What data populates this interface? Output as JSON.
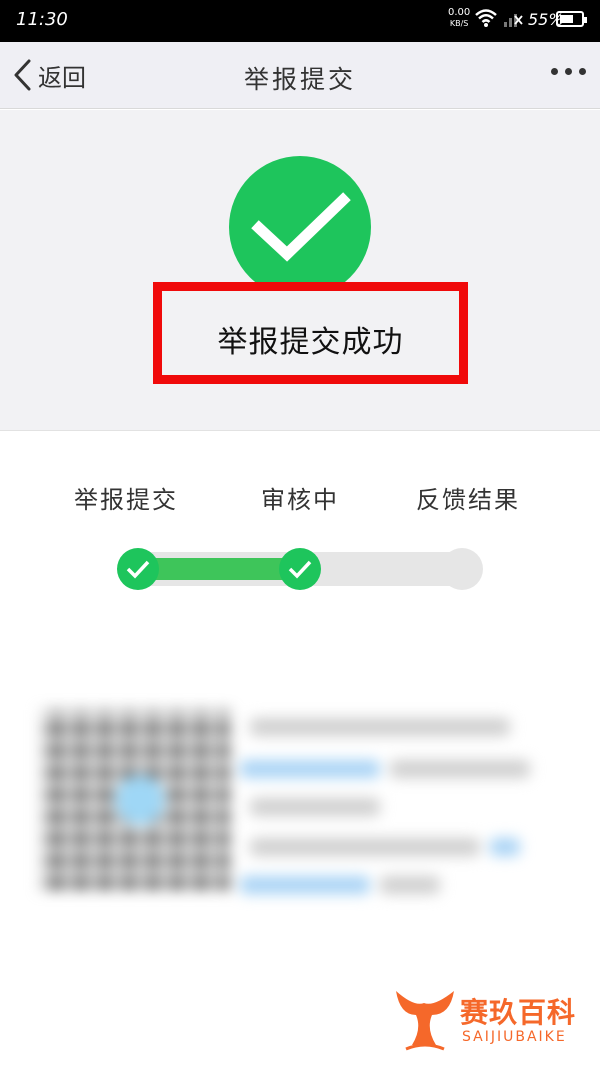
{
  "status_bar": {
    "time": "11:30",
    "net_speed_value": "0.00",
    "net_speed_unit": "KB/S",
    "battery": "55%"
  },
  "nav": {
    "back_label": "返回",
    "title": "举报提交",
    "more_icon": "more-dots-icon"
  },
  "result": {
    "icon": "check-circle-icon",
    "message": "举报提交成功",
    "highlight_color": "#f00a0a"
  },
  "progress": {
    "steps": [
      {
        "label": "举报提交",
        "done": true
      },
      {
        "label": "审核中",
        "done": true
      },
      {
        "label": "反馈结果",
        "done": false
      }
    ],
    "accent_color": "#1ec55c"
  },
  "watermark": {
    "name": "赛玖百科",
    "sub": "SAIJIUBAIKE"
  }
}
